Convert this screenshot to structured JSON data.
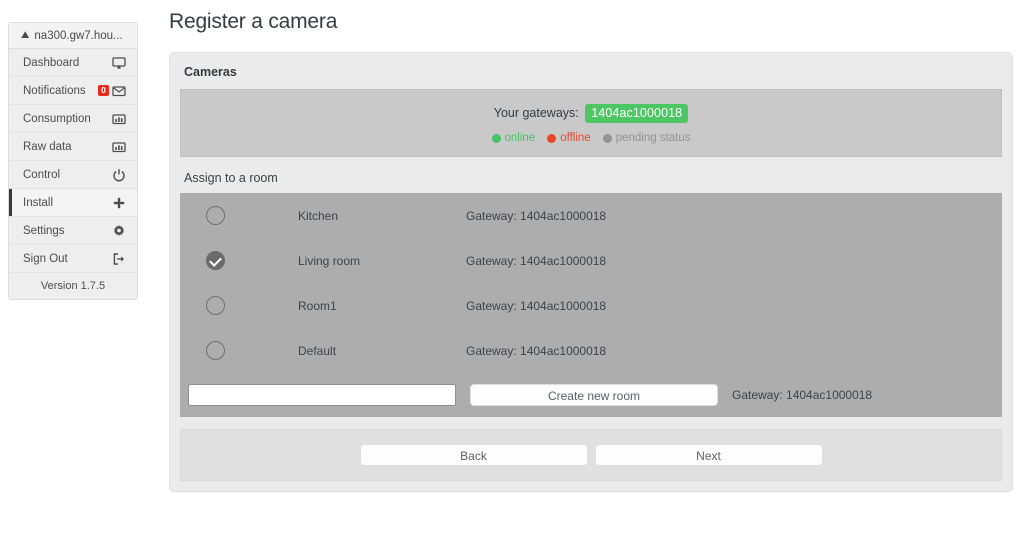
{
  "sidebar": {
    "header": {
      "icon": "home-icon",
      "label": "na300.gw7.hou..."
    },
    "items": [
      {
        "label": "Dashboard",
        "icon": "monitor-icon",
        "badge": null,
        "active": false
      },
      {
        "label": "Notifications",
        "icon": "envelope-icon",
        "badge": "0",
        "active": false
      },
      {
        "label": "Consumption",
        "icon": "bar-chart-icon",
        "badge": null,
        "active": false
      },
      {
        "label": "Raw data",
        "icon": "bar-chart-icon",
        "badge": null,
        "active": false
      },
      {
        "label": "Control",
        "icon": "power-icon",
        "badge": null,
        "active": false
      },
      {
        "label": "Install",
        "icon": "plus-icon",
        "badge": null,
        "active": true
      },
      {
        "label": "Settings",
        "icon": "gear-icon",
        "badge": null,
        "active": false
      },
      {
        "label": "Sign Out",
        "icon": "sign-out-icon",
        "badge": null,
        "active": false
      }
    ],
    "version": "Version 1.7.5",
    "badge_color": "#e8291c",
    "active_bar_color": "#3a3a3a"
  },
  "main": {
    "page_title": "Register a camera",
    "card_title": "Cameras",
    "gateway_panel": {
      "label": "Your gateways:",
      "gateway_id": "1404ac1000018",
      "gateway_badge_color": "#4cc764",
      "legend": [
        {
          "label": "online",
          "color": "#45c463"
        },
        {
          "label": "offline",
          "color": "#ec4526"
        },
        {
          "label": "pending status",
          "color": "#939393"
        }
      ]
    },
    "assign_label": "Assign to a room",
    "gateway_prefix": "Gateway: ",
    "rooms": [
      {
        "name": "Kitchen",
        "gateway": "Gateway: 1404ac1000018",
        "selected": false
      },
      {
        "name": "Living room",
        "gateway": "Gateway: 1404ac1000018",
        "selected": true
      },
      {
        "name": "Room1",
        "gateway": "Gateway: 1404ac1000018",
        "selected": false
      },
      {
        "name": "Default",
        "gateway": "Gateway: 1404ac1000018",
        "selected": false
      }
    ],
    "create_room": {
      "input_value": "",
      "input_placeholder": "",
      "button_label": "Create new room",
      "gateway": "Gateway: 1404ac1000018"
    },
    "footer": {
      "back_label": "Back",
      "next_label": "Next"
    }
  }
}
